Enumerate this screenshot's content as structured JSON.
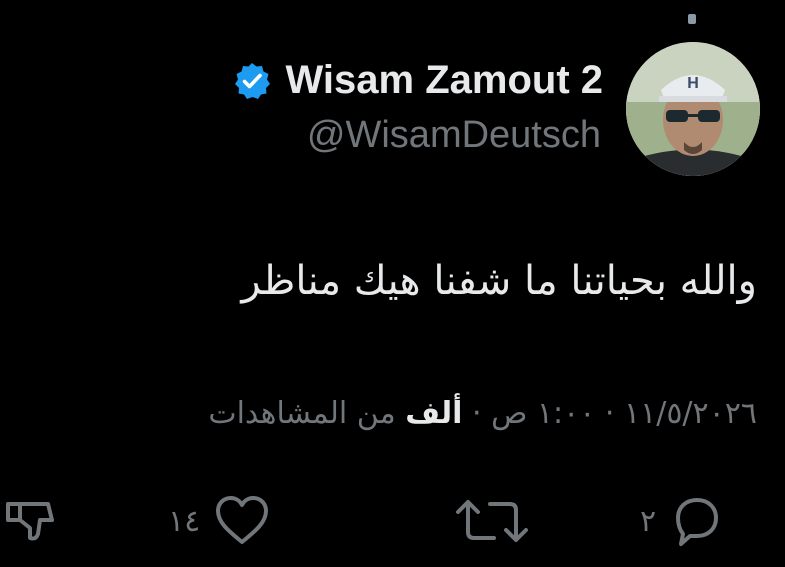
{
  "tweet": {
    "display_name": "Wisam Zamout 2",
    "handle": "@WisamDeutsch",
    "text": "والله بحياتنا ما شفنا هيك مناظر",
    "timestamp": "١١/٥/٢٠٢٦ · ١:٠٠ ص",
    "separator": "·",
    "views_count": "ألف",
    "views_label": "من المشاهدات"
  },
  "actions": {
    "reply_count": "٢",
    "like_count": "١٤"
  },
  "icons": {
    "verified": "verified-badge-icon",
    "reply": "reply-icon",
    "retweet": "retweet-icon",
    "like": "heart-icon",
    "share": "share-icon"
  },
  "colors": {
    "background": "#000000",
    "primary_text": "#e7e9ea",
    "secondary_text": "#71767b",
    "verified_blue": "#1d9bf0"
  }
}
